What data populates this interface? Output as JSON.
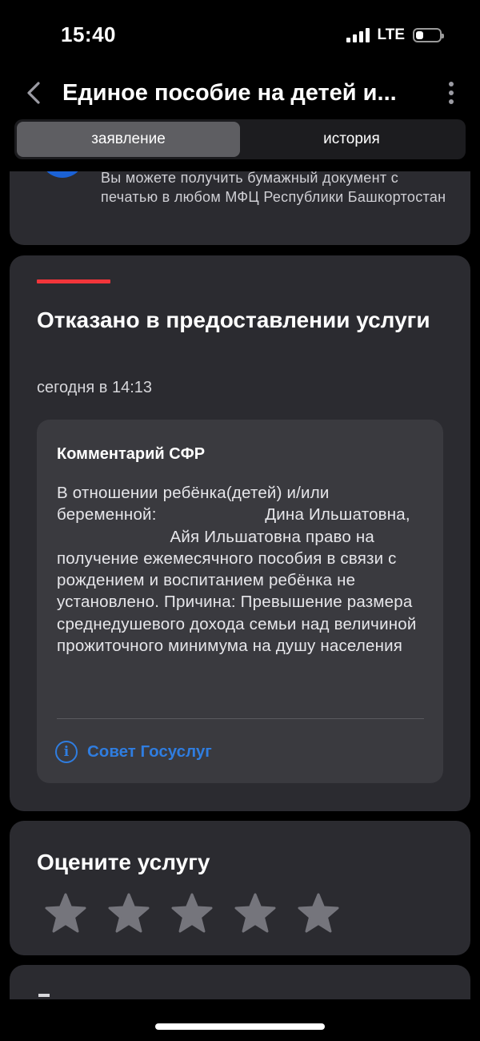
{
  "status_bar": {
    "time": "15:40",
    "network": "LTE"
  },
  "header": {
    "title": "Единое пособие на детей и...",
    "back_icon": "chevron-left-icon",
    "more_icon": "more-vertical-icon"
  },
  "tabs": [
    {
      "label": "заявление",
      "active": true
    },
    {
      "label": "история",
      "active": false
    }
  ],
  "info_card": {
    "text": "Вы можете получить бумажный документ с печатью в любом МФЦ Республики Башкортостан"
  },
  "status_card": {
    "title": "Отказано в предоставлении услуги",
    "time": "сегодня в 14:13",
    "comment": {
      "title": "Комментарий СФР",
      "body": "В отношении ребёнка(детей) и/или беременной:                       Дина Ильшатовна,                         Айя Ильшатовна право на получение ежемесячного пособия в связи с рождением и воспитанием ребёнка не установлено. Причина: Превышение размера среднедушевого дохода семьи над величиной прожиточного минимума на душу населения"
    },
    "advice_link": "Совет Госуслуг",
    "accent_color": "#f2353a",
    "link_color": "#2f7de0"
  },
  "rating_card": {
    "title": "Оцените услугу",
    "max_stars": 5,
    "selected_stars": 0
  }
}
